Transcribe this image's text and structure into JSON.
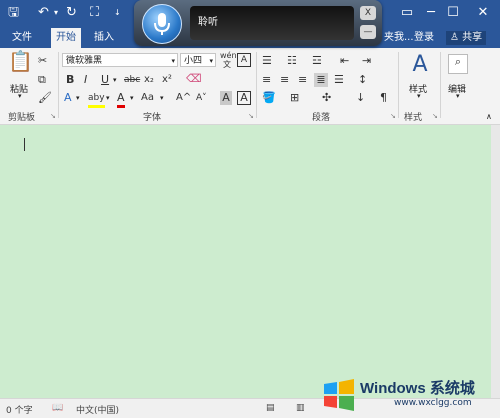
{
  "titlebar": {
    "save_icon": "save-icon",
    "undo_icon": "undo-icon",
    "redo_icon": "redo-icon",
    "touch_icon": "touch-mode-icon",
    "more": "↓",
    "ribbon_opts": "▭",
    "minimize": "─",
    "maximize": "☐",
    "close": "✕"
  },
  "tabs": {
    "file": "文件",
    "home": "开始",
    "insert": "插入",
    "right_cut": "夹我...",
    "login": "登录",
    "share": "共享"
  },
  "clipboard": {
    "paste": "粘贴",
    "label": "剪贴板"
  },
  "font": {
    "name": "微软雅黑",
    "size": "小四",
    "wen": "wén",
    "wen_char": "文",
    "A_box": "A",
    "bold": "B",
    "italic": "I",
    "underline": "U",
    "strike": "abc",
    "sub": "x₂",
    "sup": "x²",
    "effects": "A",
    "highlight": "aby",
    "color": "A",
    "case": "Aa",
    "grow": "A^",
    "shrink": "A˅",
    "charshade": "A",
    "charborder": "A",
    "label": "字体"
  },
  "paragraph": {
    "label": "段落"
  },
  "styles": {
    "btn": "样式",
    "label": "样式"
  },
  "editing": {
    "btn": "编辑"
  },
  "speech": {
    "text": "聆听",
    "close": "X",
    "min": "—"
  },
  "status": {
    "words": "0 个字",
    "lang": "中文(中国)",
    "proof_icon": "proofing-icon"
  },
  "watermark": {
    "title": "Windows 系统城",
    "url": "www.wxclgg.com"
  },
  "colors": {
    "brand": "#2b579a",
    "canvas": "#cdeccf",
    "highlight": "#ffff00",
    "font_red": "#e00000"
  }
}
